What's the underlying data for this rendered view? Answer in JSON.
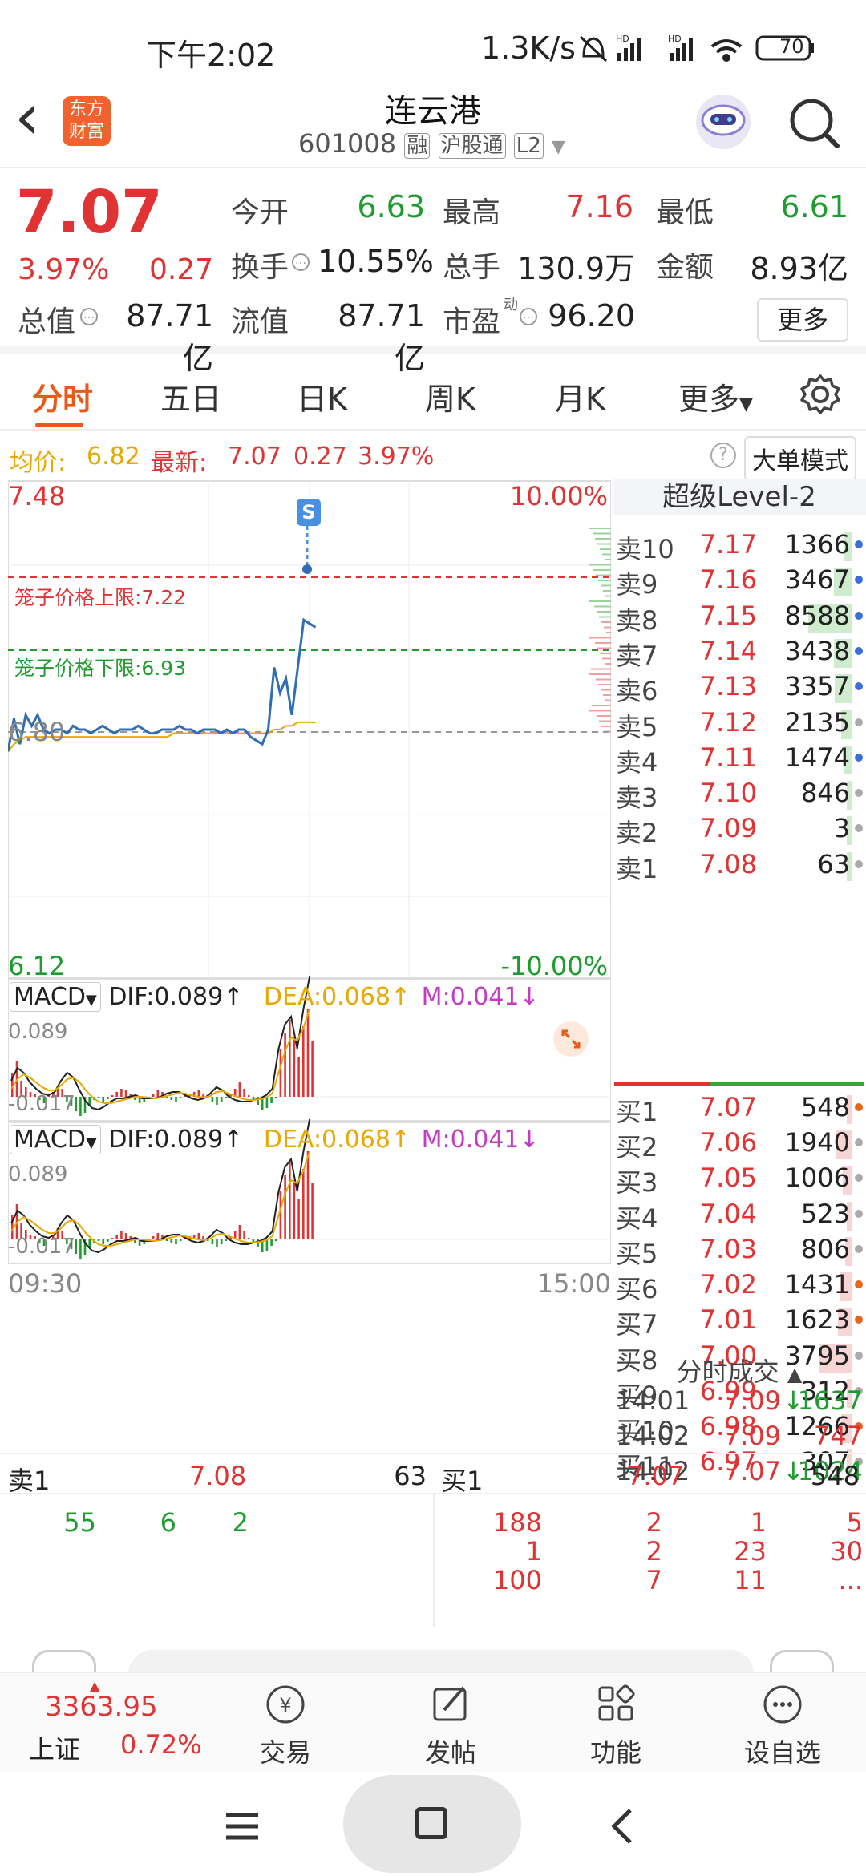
{
  "status_bar": {
    "time": "下午2:02",
    "speed": "1.3K/s",
    "battery": "70"
  },
  "header": {
    "back": "‹",
    "logo": [
      "东方",
      "财富"
    ],
    "stock_name": "连云港",
    "code": "601008",
    "tags": [
      "融",
      "沪股通",
      "L2"
    ]
  },
  "quote": {
    "price": "7.07",
    "pct": "3.97%",
    "change": "0.27",
    "open_label": "今开",
    "open": "6.63",
    "high_label": "最高",
    "high": "7.16",
    "low_label": "最低",
    "low": "6.61",
    "turnover_label": "换手",
    "turnover": "10.55%",
    "volume_label": "总手",
    "volume": "130.9万",
    "amount_label": "金额",
    "amount": "8.93亿",
    "mktcap_label": "总值",
    "mktcap": "87.71亿",
    "float_label": "流值",
    "float": "87.71亿",
    "pe_label": "市盈",
    "pe_sup": "动",
    "pe": "96.20",
    "more": "更多"
  },
  "tabs": [
    "分时",
    "五日",
    "日K",
    "周K",
    "月K",
    "更多"
  ],
  "info_row": {
    "avg_label": "均价:",
    "avg": "6.82",
    "latest_label": "最新:",
    "latest": "7.07",
    "change": "0.27",
    "pct": "3.97%",
    "mode": "大单模式"
  },
  "chart": {
    "y_top": "7.48",
    "y_bottom": "6.12",
    "pct_top": "10.00%",
    "pct_bottom": "-10.00%",
    "ref_price": "6.80",
    "cage_upper": "笼子价格上限:7.22",
    "cage_lower": "笼子价格下限:6.93",
    "s_marker": "S",
    "time_start": "09:30",
    "time_end": "15:00",
    "price_line": [
      6.74,
      6.83,
      6.76,
      6.84,
      6.81,
      6.84,
      6.8,
      6.79,
      6.8,
      6.8,
      6.79,
      6.81,
      6.8,
      6.8,
      6.79,
      6.8,
      6.81,
      6.8,
      6.79,
      6.8,
      6.8,
      6.8,
      6.81,
      6.8,
      6.79,
      6.79,
      6.8,
      6.8,
      6.8,
      6.81,
      6.8,
      6.8,
      6.79,
      6.8,
      6.8,
      6.8,
      6.79,
      6.8,
      6.79,
      6.8,
      6.8,
      6.78,
      6.77,
      6.76,
      6.8,
      6.97,
      6.9,
      6.94,
      6.84,
      6.97,
      7.1,
      7.09,
      7.08
    ],
    "avg_line": [
      6.74,
      6.76,
      6.77,
      6.78,
      6.78,
      6.78,
      6.78,
      6.78,
      6.78,
      6.78,
      6.78,
      6.78,
      6.78,
      6.78,
      6.78,
      6.78,
      6.78,
      6.78,
      6.78,
      6.78,
      6.78,
      6.78,
      6.78,
      6.78,
      6.78,
      6.78,
      6.78,
      6.78,
      6.79,
      6.79,
      6.79,
      6.79,
      6.79,
      6.79,
      6.79,
      6.79,
      6.79,
      6.79,
      6.79,
      6.79,
      6.79,
      6.79,
      6.79,
      6.79,
      6.79,
      6.8,
      6.8,
      6.81,
      6.81,
      6.82,
      6.82,
      6.82,
      6.82
    ]
  },
  "macd1": {
    "label": "MACD",
    "dif": "DIF:0.089",
    "dea": "DEA:0.068",
    "m": "M:0.041",
    "top": "0.089",
    "bottom": "-0.017"
  },
  "macd2": {
    "label": "MACD",
    "dif": "DIF:0.089",
    "dea": "DEA:0.068",
    "m": "M:0.041",
    "top": "0.089",
    "bottom": "-0.017"
  },
  "book": {
    "title": "超级Level-2",
    "asks": [
      {
        "label": "卖10",
        "price": "7.17",
        "vol": "1366"
      },
      {
        "label": "卖9",
        "price": "7.16",
        "vol": "3467"
      },
      {
        "label": "卖8",
        "price": "7.15",
        "vol": "8588"
      },
      {
        "label": "卖7",
        "price": "7.14",
        "vol": "3438"
      },
      {
        "label": "卖6",
        "price": "7.13",
        "vol": "3357"
      },
      {
        "label": "卖5",
        "price": "7.12",
        "vol": "2135"
      },
      {
        "label": "卖4",
        "price": "7.11",
        "vol": "1474"
      },
      {
        "label": "卖3",
        "price": "7.10",
        "vol": "846"
      },
      {
        "label": "卖2",
        "price": "7.09",
        "vol": "3"
      },
      {
        "label": "卖1",
        "price": "7.08",
        "vol": "63"
      }
    ],
    "bids": [
      {
        "label": "买1",
        "price": "7.07",
        "vol": "548"
      },
      {
        "label": "买2",
        "price": "7.06",
        "vol": "1940"
      },
      {
        "label": "买3",
        "price": "7.05",
        "vol": "1006"
      },
      {
        "label": "买4",
        "price": "7.04",
        "vol": "523"
      },
      {
        "label": "买5",
        "price": "7.03",
        "vol": "806"
      },
      {
        "label": "买6",
        "price": "7.02",
        "vol": "1431"
      },
      {
        "label": "买7",
        "price": "7.01",
        "vol": "1623"
      },
      {
        "label": "买8",
        "price": "7.00",
        "vol": "3795"
      },
      {
        "label": "买9",
        "price": "6.99",
        "vol": "312"
      },
      {
        "label": "买10",
        "price": "6.98",
        "vol": "1266"
      },
      {
        "label": "买11",
        "price": "6.97",
        "vol": "307"
      }
    ],
    "trades_title": "分时成交",
    "trades": [
      {
        "time": "14:01",
        "price": "7.09",
        "vol": "1637",
        "dir": "↓"
      },
      {
        "time": "14:02",
        "price": "7.09",
        "vol": "747",
        "dir": ""
      },
      {
        "time": "14:02",
        "price": "7.07",
        "vol": "1024",
        "dir": "↓"
      }
    ]
  },
  "bottom_table": {
    "sell_label": "卖1",
    "sell_price": "7.08",
    "sell_vol": "63",
    "buy_label": "买1",
    "buy_price": "7.07",
    "buy_vol": "548",
    "sell_queue": [
      "55",
      "6",
      "2"
    ],
    "buy_queue": [
      [
        "188",
        "2",
        "1",
        "5"
      ],
      [
        "1",
        "2",
        "23",
        "30"
      ],
      [
        "100",
        "7",
        "11",
        "..."
      ]
    ]
  },
  "bottom_nav": {
    "index_value": "3363.95",
    "index_name": "上证",
    "index_pct": "0.72%",
    "items": [
      "交易",
      "发帖",
      "功能",
      "设自选"
    ]
  }
}
